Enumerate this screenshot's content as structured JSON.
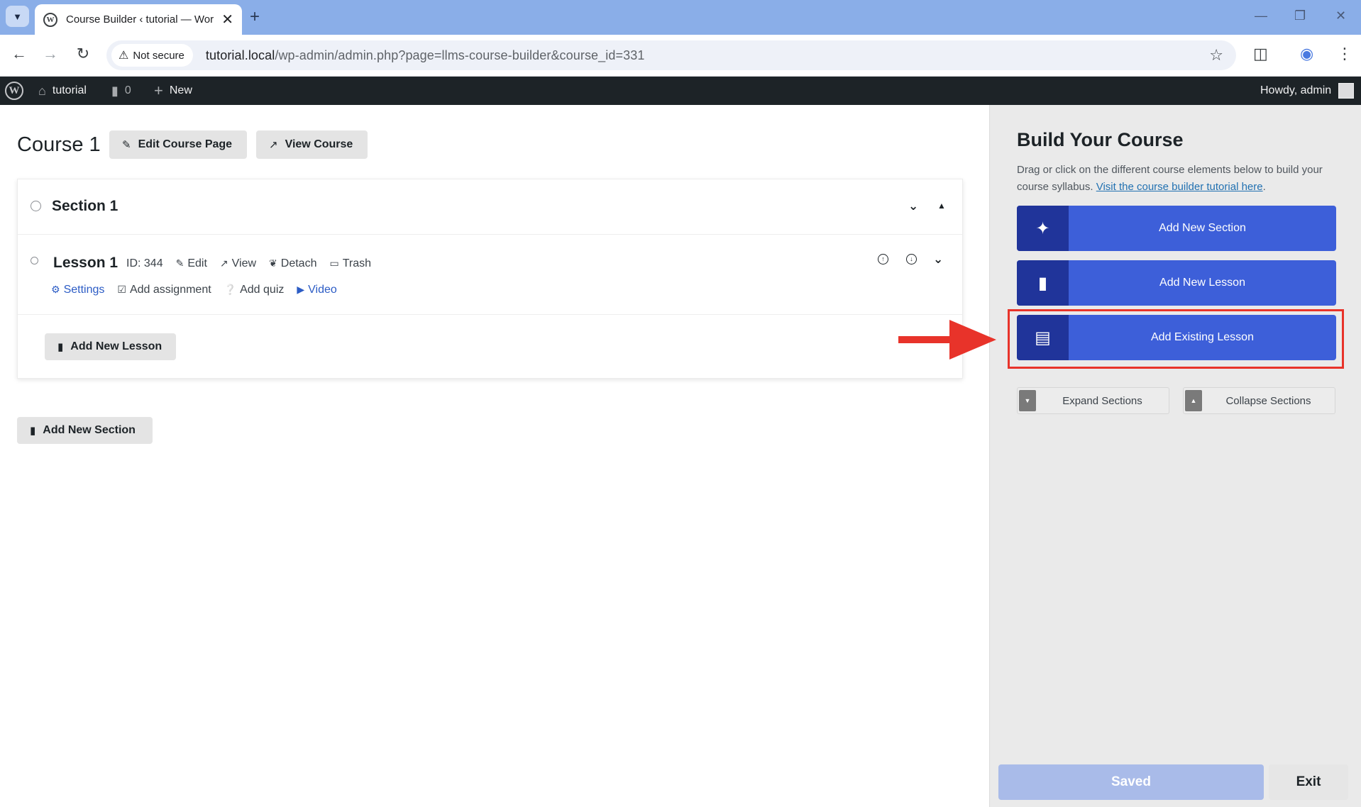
{
  "browser": {
    "tab_title": "Course Builder ‹ tutorial — Wor",
    "security_label": "Not secure",
    "url_host": "tutorial.local",
    "url_path": "/wp-admin/admin.php?page=llms-course-builder&course_id=331"
  },
  "adminbar": {
    "site_name": "tutorial",
    "comments_count": "0",
    "new_label": "New",
    "howdy": "Howdy, admin"
  },
  "course": {
    "title": "Course 1",
    "edit_page_label": "Edit Course Page",
    "view_course_label": "View Course"
  },
  "section": {
    "title": "Section 1",
    "add_lesson_label": "Add New Lesson"
  },
  "lesson": {
    "title": "Lesson 1",
    "id_label": "ID: 344",
    "edit": "Edit",
    "view": "View",
    "detach": "Detach",
    "trash": "Trash",
    "settings": "Settings",
    "add_assignment": "Add assignment",
    "add_quiz": "Add quiz",
    "video": "Video"
  },
  "add_section_label": "Add New Section",
  "sidebar": {
    "title": "Build Your Course",
    "desc": "Drag or click on the different course elements below to build your course syllabus.",
    "tutorial_link": "Visit the course builder tutorial here",
    "desc_end": ".",
    "buttons": [
      {
        "label": "Add New Section",
        "icon": "puzzle-icon"
      },
      {
        "label": "Add New Lesson",
        "icon": "file-icon"
      },
      {
        "label": "Add Existing Lesson",
        "icon": "file-text-icon"
      }
    ],
    "expand_label": "Expand Sections",
    "collapse_label": "Collapse Sections",
    "saved_label": "Saved",
    "exit_label": "Exit"
  },
  "colors": {
    "accent": "#3d5fd9",
    "accent_dark": "#20349a",
    "highlight": "#e8332a",
    "adminbar": "#1d2327"
  }
}
